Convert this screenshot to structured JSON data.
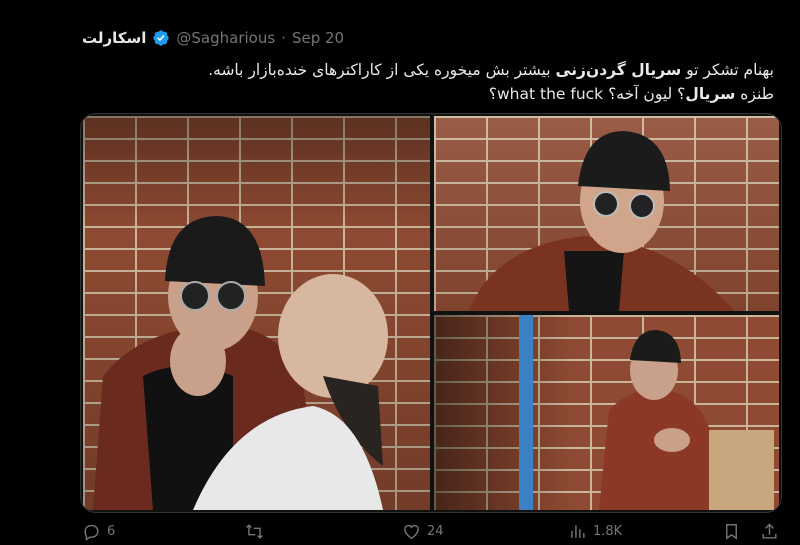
{
  "tweet": {
    "display_name": "اسکارلت",
    "handle": "@Sagharious",
    "separator": "·",
    "date": "Sep 20",
    "text_line1_a": "بهنام تشکر تو ",
    "text_line1_b": "سریال گردن‌زنی",
    "text_line1_c": " بیشتر بش میخوره یکی از کاراکترهای خنده‌بازار باشه.",
    "text_line2_a": "طنزه ",
    "text_line2_b": "سریال",
    "text_line2_c": "؟ لیون آخه؟ what the fuck؟"
  },
  "media": {
    "image_count": 3
  },
  "actions": {
    "replies": "6",
    "retweets": "",
    "likes": "24",
    "views": "1.8K"
  },
  "icons": {
    "verified": "verified-badge-icon",
    "reply": "reply-icon",
    "retweet": "retweet-icon",
    "like": "heart-icon",
    "views": "views-chart-icon",
    "bookmark": "bookmark-icon",
    "share": "share-icon"
  },
  "colors": {
    "background": "#000000",
    "text": "#e7e9ea",
    "secondary": "#71767b",
    "verified": "#1d9bf0"
  }
}
